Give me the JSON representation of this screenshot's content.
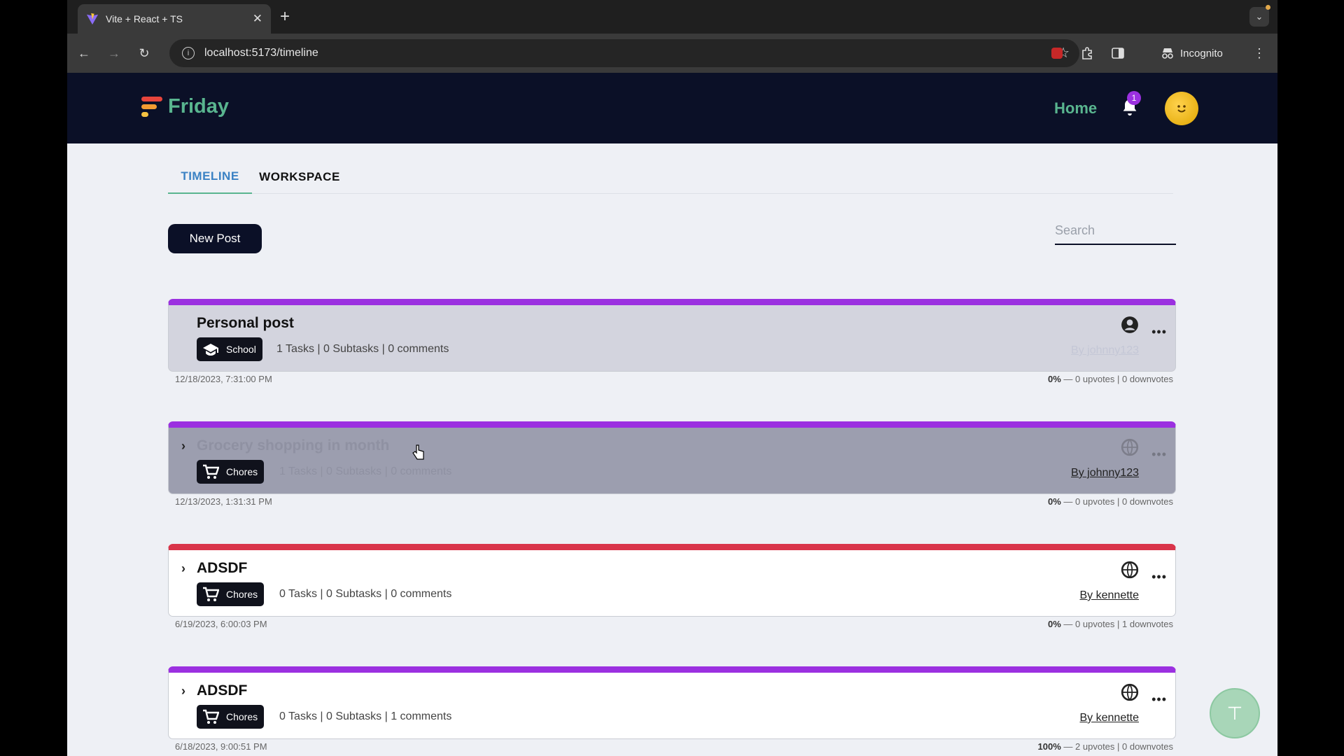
{
  "browser": {
    "tab_title": "Vite + React + TS",
    "tab_close": "✕",
    "new_tab": "+",
    "url": "localhost:5173/timeline",
    "profile_label": "Incognito"
  },
  "app": {
    "brand": "Friday",
    "nav_home": "Home",
    "notification_count": "1"
  },
  "tabs": {
    "timeline": "TIMELINE",
    "workspace": "WORKSPACE"
  },
  "actions": {
    "new_post": "New Post",
    "search_placeholder": "Search"
  },
  "posts": [
    {
      "title": "Personal post",
      "category": "School",
      "meta": "1 Tasks | 0 Subtasks | 0 comments",
      "author": "By johnny123",
      "date": "12/18/2023, 7:31:00 PM",
      "percent": "0%",
      "votes": "0 upvotes | 0 downvotes",
      "visibility": "private",
      "accent": "#9b30e0"
    },
    {
      "title": "Grocery shopping in month",
      "category": "Chores",
      "meta": "1 Tasks | 0 Subtasks | 0 comments",
      "author": "By johnny123",
      "date": "12/13/2023, 1:31:31 PM",
      "percent": "0%",
      "votes": "0 upvotes | 0 downvotes",
      "visibility": "public",
      "accent": "#9b30e0"
    },
    {
      "title": "ADSDF",
      "category": "Chores",
      "meta": "0 Tasks | 0 Subtasks | 0 comments",
      "author": "By kennette",
      "date": "6/19/2023, 6:00:03 PM",
      "percent": "0%",
      "votes": "0 upvotes | 1 downvotes",
      "visibility": "public",
      "accent": "#d9344a"
    },
    {
      "title": "ADSDF",
      "category": "Chores",
      "meta": "0 Tasks | 0 Subtasks | 1 comments",
      "author": "By kennette",
      "date": "6/18/2023, 9:00:51 PM",
      "percent": "100%",
      "votes": "2 upvotes | 0 downvotes",
      "visibility": "public",
      "accent": "#9b30e0"
    }
  ],
  "icons": {
    "chevron": "chevron-right-icon",
    "private": "user-circle-icon",
    "public": "globe-icon",
    "school": "graduation-cap-icon",
    "chores": "shopping-cart-icon",
    "more": "more-horizontal-icon"
  },
  "colors": {
    "brand_green": "#59b58f",
    "header_navy": "#0b1027",
    "tab_blue": "#3b82c4",
    "accent_purple": "#9b30e0",
    "accent_red": "#d9344a"
  }
}
